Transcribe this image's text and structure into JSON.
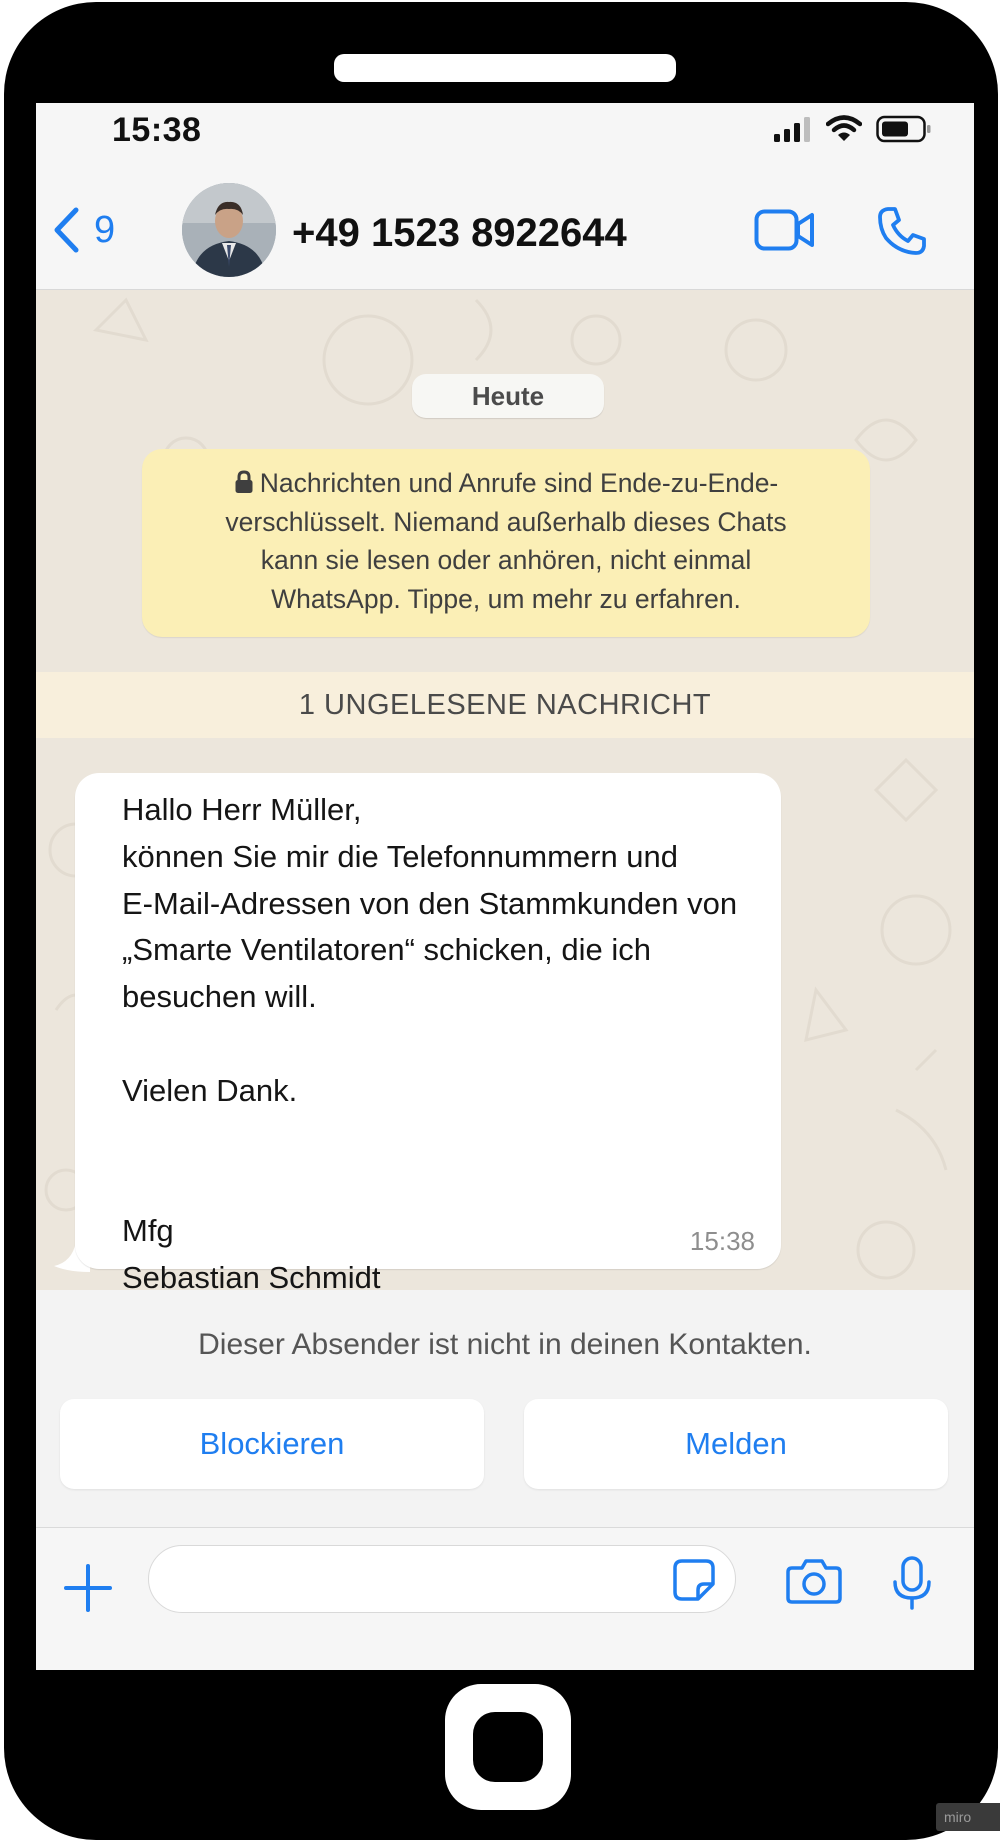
{
  "status_bar": {
    "time": "15:38",
    "icons": [
      "signal-icon",
      "wifi-icon",
      "battery-icon"
    ]
  },
  "header": {
    "back_icon": "chevron-left-icon",
    "back_count": "9",
    "contact_name": "+49 1523 8922644",
    "video_call_icon": "video-camera-icon",
    "voice_call_icon": "phone-icon"
  },
  "chat": {
    "date_label": "Heute",
    "encryption_notice": "Nachrichten und Anrufe sind Ende-zu-Ende-\nverschlüsselt. Niemand außerhalb dieses Chats\nkann sie lesen oder anhören, nicht einmal\nWhatsApp. Tippe, um mehr zu erfahren.",
    "unread_label": "1 UNGELESENE NACHRICHT",
    "message": {
      "text": "Hallo Herr Müller,\nkönnen Sie mir die Telefonnummern und\nE-Mail-Adressen von den Stammkunden von\n„Smarte Ventilatoren“ schicken, die ich\nbesuchen will.\n\nVielen Dank.\n\n\nMfg\nSebastian Schmidt",
      "time": "15:38"
    },
    "unknown_sender_notice": "Dieser Absender ist nicht in deinen Kontakten.",
    "block_label": "Blockieren",
    "report_label": "Melden"
  },
  "input_bar": {
    "input_value": "",
    "icons": [
      "plus-icon",
      "sticker-icon",
      "camera-icon",
      "microphone-icon"
    ]
  },
  "colors": {
    "accent": "#1f7ef0",
    "notice_bg": "#fbefb6",
    "chat_bg": "#ece6dc"
  },
  "watermark": "miro"
}
